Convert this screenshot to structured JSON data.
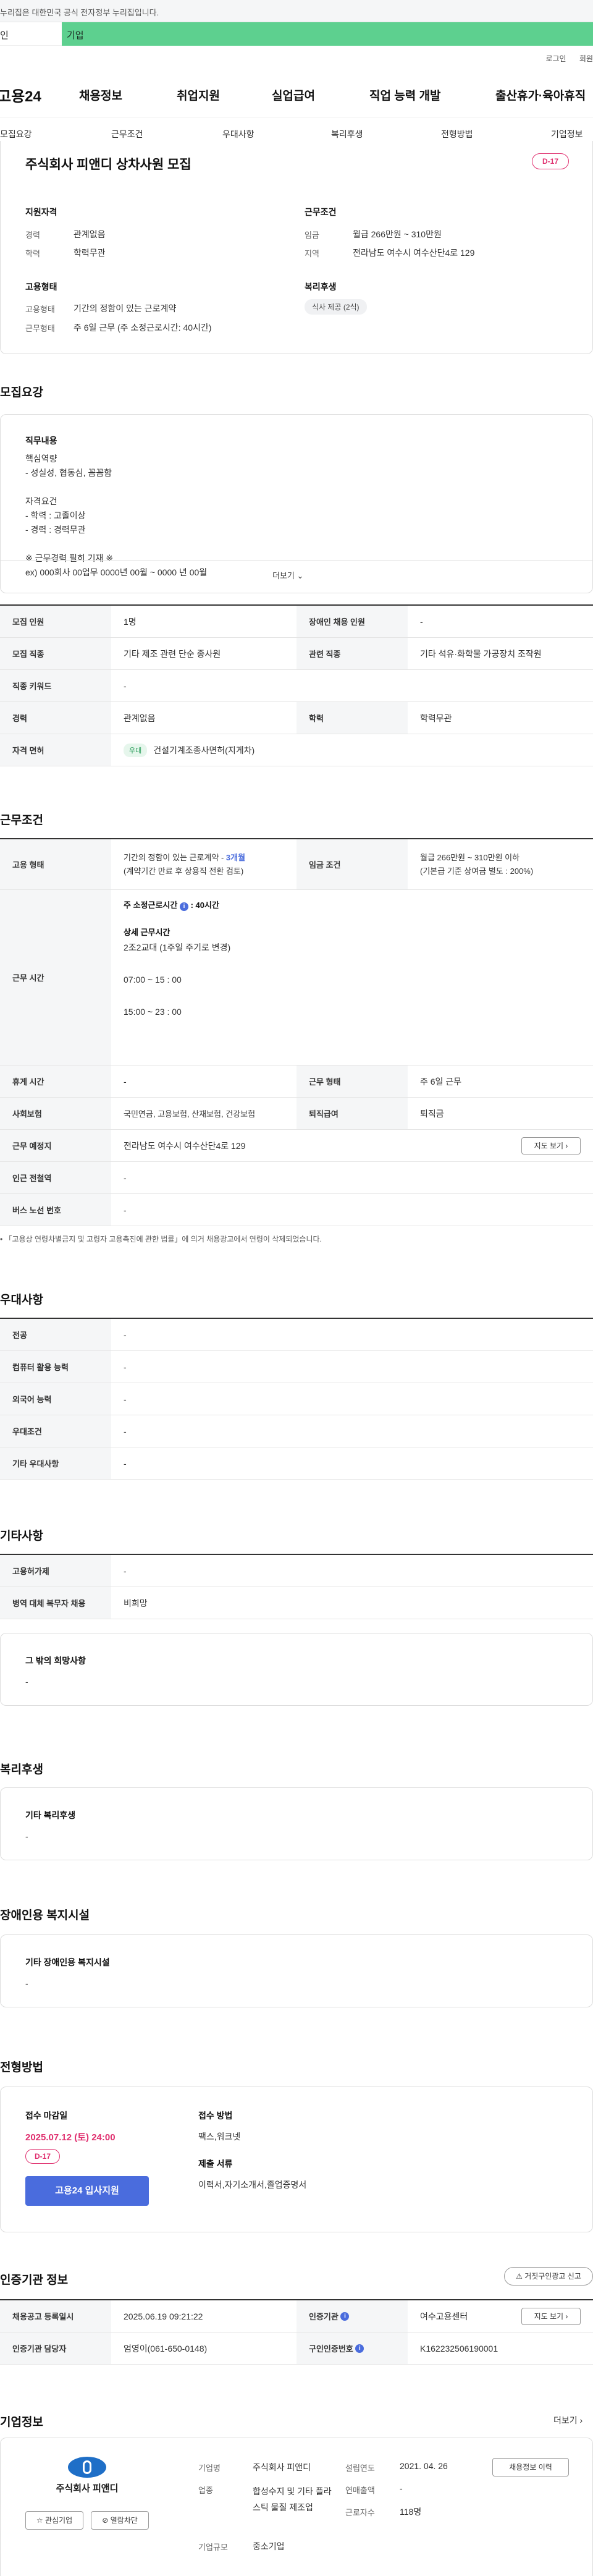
{
  "gov_bar": {
    "text": "누리집은 대한민국 공식 전자정부 누리집입니다."
  },
  "user_toggle": {
    "personal": "인",
    "business": "기업"
  },
  "top_links": {
    "login": "로그인",
    "join": "회원"
  },
  "gnb": {
    "logo": "고용24",
    "items": [
      "채용정보",
      "취업지원",
      "실업급여",
      "직업 능력 개발",
      "출산휴가·육아휴직"
    ]
  },
  "sub_tabs": [
    "모집요강",
    "근무조건",
    "우대사항",
    "복리후생",
    "전형방법",
    "기업정보"
  ],
  "summary": {
    "title": "주식회사 피앤디 상차사원 모집",
    "dday": "D-17",
    "qual_title": "지원자격",
    "career_label": "경력",
    "career_value": "관계없음",
    "edu_label": "학력",
    "edu_value": "학력무관",
    "cond_title": "근무조건",
    "wage_label": "임금",
    "wage_value": "월급 266만원 ~ 310만원",
    "region_label": "지역",
    "region_value": "전라남도 여수시 여수산단4로 129",
    "emp_title": "고용형태",
    "emp_label": "고용형태",
    "emp_value": "기간의 정함이 있는 근로계약",
    "worktype_label": "근무형태",
    "worktype_value": "주 6일 근무 (주 소정근로시간: 40시간)",
    "welfare_title": "복리후생",
    "welfare_badge": "식사 제공 (2식)"
  },
  "recruit": {
    "section_title": "모집요강",
    "job_title": "직무내용",
    "lines": [
      "핵심역량",
      "- 성실성, 협동심, 꼼꼼함",
      "",
      "자격요건",
      "- 학력 : 고졸이상",
      "- 경력 : 경력무관",
      "",
      "※ 근무경력 필히 기재 ※",
      "ex) 000회사 00업무 0000년 00월 ~ 0000 년 00월"
    ],
    "more": "더보기",
    "table": [
      {
        "l1": "모집 인원",
        "v1": "1명",
        "l2": "장애인 채용 인원",
        "v2": "-"
      },
      {
        "l1": "모집 직종",
        "v1": "기타 제조 관련 단순 종사원",
        "l2": "관련 직종",
        "v2": "기타 석유·화학물 가공장치 조작원"
      },
      {
        "l1": "직종 키워드",
        "v1": "-"
      },
      {
        "l1": "경력",
        "v1": "관계없음",
        "l2": "학력",
        "v2": "학력무관"
      },
      {
        "l1": "자격 면허",
        "badge": "우대",
        "v1": "건설기계조종사면허(지게차)"
      }
    ]
  },
  "work": {
    "section_title": "근무조건",
    "emp_label": "고용 형태",
    "emp_value": "기간의 정함이 있는 근로계약 - ",
    "emp_months": "3개월",
    "emp_sub": "(계약기간 만료 후 상용직 전환 검토)",
    "wage_label": "임금 조건",
    "wage_value": "월급 266만원 ~ 310만원 이하",
    "wage_sub": "(기본급 기준 상여금 별도 : 200%)",
    "time_label": "근무 시간",
    "weekly_hours": "주 소정근로시간",
    "weekly_hours_value": ": 40시간",
    "detail_title": "상세 근무시간",
    "detail_lines": [
      "2조2교대 (1주일 주기로 변경)",
      "",
      "07:00  ~ 15 : 00",
      "",
      "15:00  ~ 23 : 00"
    ],
    "rest_label": "휴게 시간",
    "rest_value": "-",
    "form_label": "근무 형태",
    "form_value": "주 6일 근무",
    "ins_label": "사회보험",
    "ins_value": "국민연금, 고용보험, 산재보험, 건강보험",
    "sev_label": "퇴직급여",
    "sev_value": "퇴직금",
    "place_label": "근무 예정지",
    "place_value": "전라남도 여수시 여수산단4로 129",
    "map_button": "지도 보기",
    "station_label": "인근 전철역",
    "station_value": "-",
    "bus_label": "버스 노선 번호",
    "bus_value": "-",
    "note": "「고용상 연령차별금지 및 고령자 고용촉진에 관한 법률」에 의거 채용광고에서 연령이 삭제되었습니다."
  },
  "prefer": {
    "section_title": "우대사항",
    "rows": [
      {
        "label": "전공",
        "value": "-"
      },
      {
        "label": "컴퓨터 활용 능력",
        "value": "-"
      },
      {
        "label": "외국어 능력",
        "value": "-"
      },
      {
        "label": "우대조건",
        "value": "-"
      },
      {
        "label": "기타 우대사항",
        "value": "-"
      }
    ]
  },
  "etc": {
    "section_title": "기타사항",
    "rows": [
      {
        "label": "고용허가제",
        "value": "-"
      },
      {
        "label": "병역 대체 복무자 채용",
        "value": "비희망"
      }
    ],
    "hope_title": "그 밖의 희망사항",
    "hope_value": "-"
  },
  "welfare": {
    "section_title": "복리후생",
    "box_title": "기타 복리후생",
    "box_value": "-"
  },
  "disability": {
    "section_title": "장애인용 복지시설",
    "box_title": "기타 장애인용 복지시설",
    "box_value": "-"
  },
  "screening": {
    "section_title": "전형방법",
    "deadline_label": "접수 마감일",
    "deadline_value": "2025.07.12 (토) 24:00",
    "dday": "D-17",
    "apply_button": "고용24 입사지원",
    "method_label": "접수 방법",
    "method_value": "팩스,워크넷",
    "docs_label": "제출 서류",
    "docs_value": "이력서,자기소개서,졸업증명서"
  },
  "cert": {
    "section_title": "인증기관 정보",
    "report_button": "거짓구인광고 신고",
    "reg_label": "채용공고 등록일시",
    "reg_value": "2025.06.19 09:21:22",
    "org_label": "인증기관",
    "org_value": "여수고용센터",
    "map_button": "지도 보기",
    "mgr_label": "인증기관 담당자",
    "mgr_value": "엄영이(061-650-0148)",
    "num_label": "구인인증번호",
    "num_value": "K162232506190001"
  },
  "company": {
    "section_title": "기업정보",
    "more": "더보기",
    "logo_text": "주식회사 피앤디",
    "interest_button": "관심기업",
    "block_button": "열람차단",
    "name_label": "기업명",
    "name_value": "주식회사 피앤디",
    "founded_label": "설립연도",
    "founded_value": "2021. 04. 26",
    "biz_label": "업종",
    "biz_value": "합성수지 및 기타 플라스틱 물질 제조업",
    "sales_label": "연매출액",
    "sales_value": "-",
    "emp_label": "근로자수",
    "emp_value": "118명",
    "scale_label": "기업규모",
    "scale_value": "중소기업",
    "jobs_button": "채용정보 이력"
  },
  "colors": {
    "accent_green": "#5dd08f",
    "primary_blue": "#4a6cdd",
    "dday_pink": "#e0306f"
  }
}
